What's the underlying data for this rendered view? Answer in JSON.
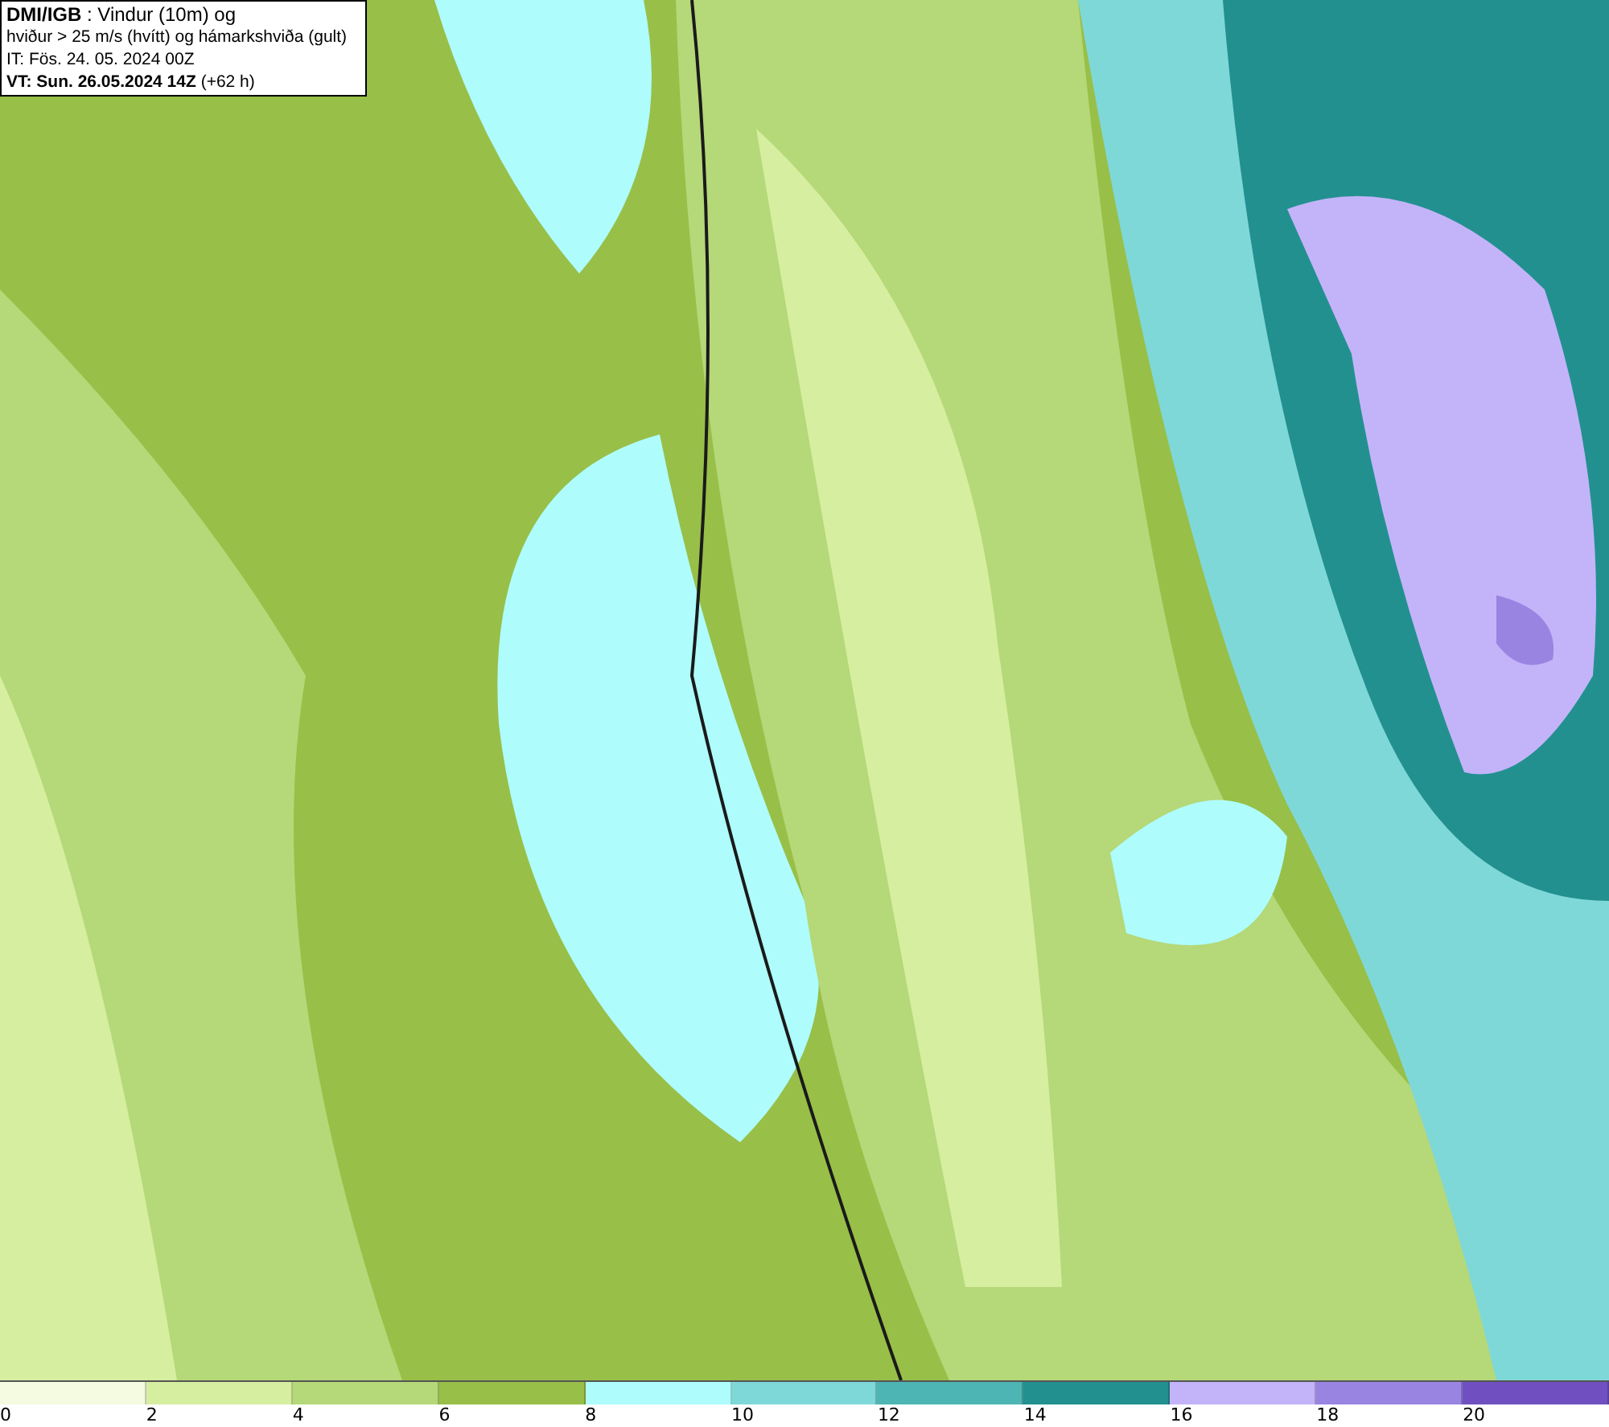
{
  "header": {
    "lines": [
      "**DMI/IGB** : Vindur (10m) og",
      "hviður > 25 m/s (hvítt) og hámarkshviða (gult)",
      "IT: Fös. 24. 05. 2024 00Z",
      "**VT: Sun. 26.05.2024 14Z** (+62 h)"
    ]
  },
  "legend": {
    "bins": [
      {
        "label": "0",
        "color": "#f4fbe0"
      },
      {
        "label": "2",
        "color": "#d6eea0"
      },
      {
        "label": "4",
        "color": "#b5d878"
      },
      {
        "label": "6",
        "color": "#98bf48"
      },
      {
        "label": "8",
        "color": "#aefcfc"
      },
      {
        "label": "10",
        "color": "#7fd8d8"
      },
      {
        "label": "12",
        "color": "#4db5b3"
      },
      {
        "label": "14",
        "color": "#239090"
      },
      {
        "label": "16",
        "color": "#c3b4f9"
      },
      {
        "label": "18",
        "color": "#9a84e2"
      },
      {
        "label": "20",
        "color": "#7050c0"
      }
    ]
  }
}
